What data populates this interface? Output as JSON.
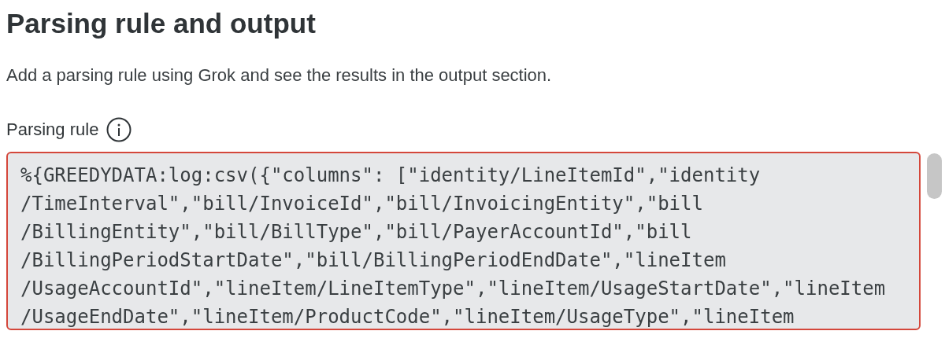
{
  "title": "Parsing rule and output",
  "description": "Add a parsing rule using Grok and see the results in the output section.",
  "parsing_rule": {
    "label": "Parsing rule",
    "invalid": true,
    "lines": [
      "%{GREEDYDATA:log:csv({\"columns\": [\"identity/LineItemId\",\"identity",
      "/TimeInterval\",\"bill/InvoiceId\",\"bill/InvoicingEntity\",\"bill",
      "/BillingEntity\",\"bill/BillType\",\"bill/PayerAccountId\",\"bill",
      "/BillingPeriodStartDate\",\"bill/BillingPeriodEndDate\",\"lineItem",
      "/UsageAccountId\",\"lineItem/LineItemType\",\"lineItem/UsageStartDate\",\"lineItem",
      "/UsageEndDate\",\"lineItem/ProductCode\",\"lineItem/UsageType\",\"lineItem"
    ]
  }
}
